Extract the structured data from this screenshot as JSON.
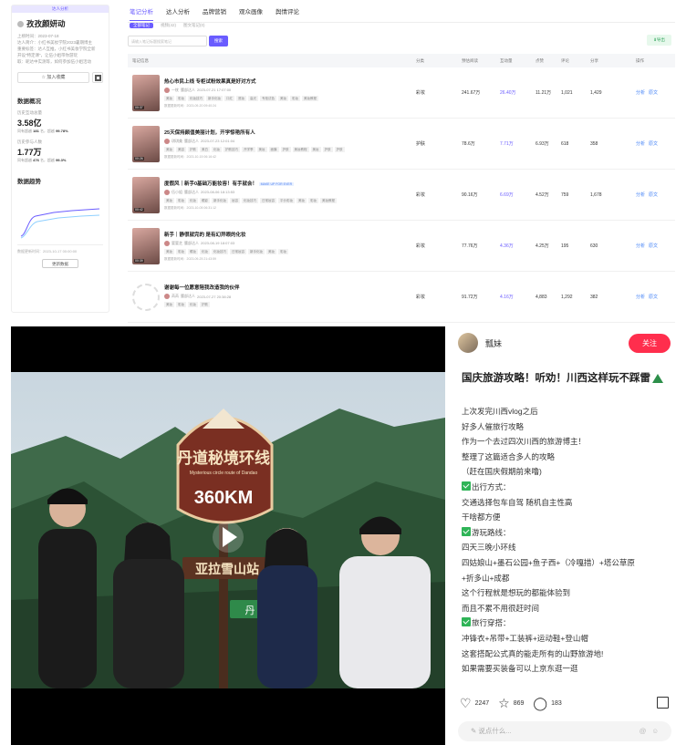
{
  "profile": {
    "tag": "达人分析",
    "name": "孜孜颜妍动",
    "meta": [
      "上榜时间：2023-07-18",
      "达人简介：小红书美妆学院2023暑期博主",
      "重要标签：达人互推，小红书美妆学院全新",
      "开设“特定课”，让伍小姐带你游玩",
      "取：昵达中实测等，如何参加伍小姐活动"
    ],
    "fav_label": "加入收藏",
    "sections": {
      "overview": "数据概况",
      "trend": "数据趋势"
    },
    "stats": [
      {
        "label": "历史互动总量",
        "value": "3.58亿",
        "sub_a": "同有超越",
        "sub_b": "181",
        "sub_c": "名，超越",
        "sub_d": "99.78%"
      },
      {
        "label": "历史参与人数",
        "value": "1.77万",
        "sub_a": "同有超越",
        "sub_b": "476",
        "sub_c": "名，超越",
        "sub_d": "99.3%"
      }
    ],
    "update": "数据更新时间：2023-10-17 00:00:00",
    "more_label": "更新数据"
  },
  "tabs": [
    "笔记分析",
    "达人分析",
    "品牌营销",
    "观众画像",
    "舆情评论"
  ],
  "subtabs": [
    "全部笔记",
    "视频(42)",
    "图文笔记(0)"
  ],
  "search": {
    "placeholder": "请输入笔记标题搜索笔记",
    "button": "搜索"
  },
  "export_label": "导出",
  "columns": [
    "笔记信息",
    "分类",
    "预估阅读",
    "互动量",
    "点赞",
    "评论",
    "分享",
    "操作"
  ],
  "notes": [
    {
      "title": "热心市民上线 专柜试粉效果真是好对方式",
      "author": "一枕",
      "auth": "腰部达人",
      "date": "2023-07-21 17:07:00",
      "tags": [
        "美妆",
        "彩妆",
        "化妆技巧",
        "新手化妆",
        "口红",
        "底妆",
        "高光",
        "专柜试色",
        "美妆",
        "彩妆",
        "美妆教程"
      ],
      "update": "数据更新时间：2023-09-20 09:40:24",
      "dur": "00:37",
      "cat": "彩妆",
      "read": "241.67万",
      "inter": "26.40万",
      "like": "11.21万",
      "com": "1,021",
      "share": "1,429"
    },
    {
      "title": "25天保持颜值美丽计划，开学惊艳所有人",
      "author": "琪琪美",
      "auth": "腰部达人",
      "date": "2023-07-23 12:01:04",
      "tags": [
        "美妆",
        "美容",
        "护肤",
        "美白",
        "化妆",
        "护肤技巧",
        "开学季",
        "美妆",
        "面膜",
        "护肤",
        "美妆教程",
        "美妆",
        "护肤",
        "护肤"
      ],
      "update": "数据更新时间：2023-10-15 06:16:42",
      "dur": "00:26",
      "cat": "护肤",
      "read": "78.6万",
      "inter": "7.71万",
      "like": "6.93万",
      "com": "618",
      "share": "358"
    },
    {
      "title": "度假风｜新手0基础万能妆容！有手就会！",
      "badge": "MAKE UP FOR EVER",
      "author": "伍小姐",
      "auth": "腰部达人",
      "date": "2023-08-06 18:13:53",
      "tags": [
        "美妆",
        "彩妆",
        "化妆",
        "眼影",
        "新手化妆",
        "妆容",
        "化妆技巧",
        "日常妆容",
        "平价彩妆",
        "美妆",
        "彩妆",
        "美妆教程"
      ],
      "update": "数据更新时间：2023-10-05 06:31:12",
      "dur": "00:42",
      "cat": "彩妆",
      "read": "90.16万",
      "inter": "6.69万",
      "like": "4.52万",
      "com": "759",
      "share": "1,678"
    },
    {
      "title": "新手｜静很就完的 是有幻异眼的化妆",
      "author": "婴婴芝",
      "auth": "腰部达人",
      "date": "2023-08-19 18:07:03",
      "tags": [
        "美妆",
        "彩妆",
        "眼妆",
        "化妆",
        "化妆技巧",
        "日常妆容",
        "新手化妆",
        "美妆",
        "彩妆"
      ],
      "update": "数据更新时间：2023-09-25 21:43:59",
      "dur": "00:39",
      "cat": "彩妆",
      "read": "77.76万",
      "inter": "4.36万",
      "like": "4.25万",
      "com": "195",
      "share": "630"
    },
    {
      "title": "谢谢每一位愿意陪我改造我的伙伴",
      "author": "芮芮",
      "auth": "腰部达人",
      "date": "2023-07-27 20:38:28",
      "tags": [
        "美妆",
        "彩妆",
        "化妆",
        "护肤"
      ],
      "update": "",
      "dur": "",
      "cat": "彩妆",
      "read": "91.72万",
      "inter": "4.16万",
      "like": "4,883",
      "com": "1,292",
      "share": "382"
    }
  ],
  "ops": [
    "分析",
    "原文"
  ],
  "post": {
    "author": "瓢妹",
    "follow": "关注",
    "title": "国庆旅游攻略！听劝！川西这样玩不踩雷",
    "lines": [
      {
        "text": "上次发完川西vlog之后",
        "check": false
      },
      {
        "text": "好多人催旅行攻略",
        "check": false
      },
      {
        "text": "作为一个去过四次川西的旅游博主！",
        "check": false
      },
      {
        "text": "整理了这篇适合多人的攻略 ",
        "check": false
      },
      {
        "text": "（赶在国庆假期前来噜)",
        "check": false
      },
      {
        "text": "出行方式：",
        "check": true
      },
      {
        "text": "交通选择包车自驾 随机自主性高",
        "check": false
      },
      {
        "text": "干啥都方便",
        "check": false
      },
      {
        "text": "游玩路线：",
        "check": true
      },
      {
        "text": "四天三晚小环线",
        "check": false
      },
      {
        "text": "四姑娘山+墨石公园+鱼子西+（冷嘎措）+塔公草原",
        "check": false
      },
      {
        "text": "+折多山+成都",
        "check": false
      },
      {
        "text": "这个行程就是想玩的都能体验到",
        "check": false
      },
      {
        "text": "而且不累不用很赶时间",
        "check": false
      },
      {
        "text": "旅行穿搭：",
        "check": true
      },
      {
        "text": "冲锋衣+吊带+工装裤+运动鞋+登山帽",
        "check": false
      },
      {
        "text": "这套搭配公式真的能走所有的山野旅游地!",
        "check": false
      },
      {
        "text": "如果需要买装备可以上京东逛一逛",
        "check": false
      }
    ],
    "likes": "2247",
    "stars": "869",
    "comments": "183",
    "comment_placeholder": "说点什么...",
    "video_sign_top": "丹道秘境环线",
    "video_sign_sub": "Mysterious circle route of Dandao",
    "video_sign_km": "360KM",
    "video_sign_2": "亚拉雪山站",
    "video_sign_3": "丹"
  },
  "colors": {
    "accent": "#6a5cff",
    "follow": "#ff2e4d",
    "check": "#2fb457",
    "link": "#3f7ff6"
  }
}
